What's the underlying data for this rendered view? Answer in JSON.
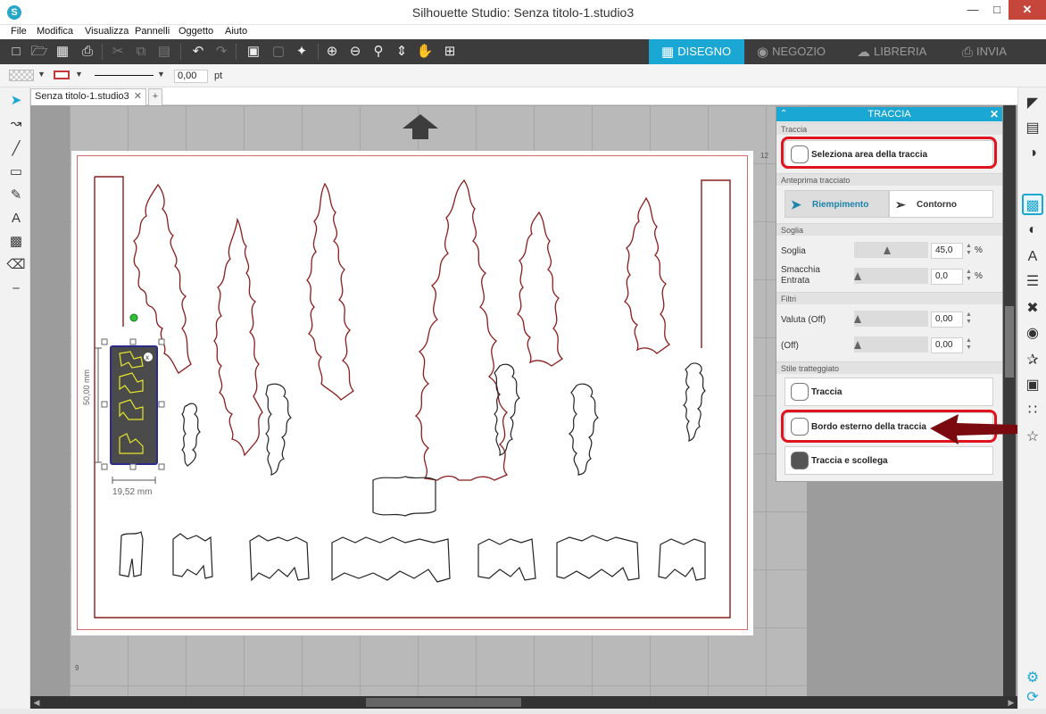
{
  "window": {
    "title": "Silhouette Studio: Senza titolo-1.studio3",
    "app_icon": "S"
  },
  "menu": [
    "File",
    "Modifica",
    "Visualizza",
    "Pannelli",
    "Oggetto",
    "Aiuto"
  ],
  "nav_tabs": [
    "DISEGNO",
    "NEGOZIO",
    "LIBRERIA",
    "INVIA"
  ],
  "options": {
    "line_width": "0,00",
    "line_unit": "pt",
    "line_color": "#c8373b"
  },
  "document_tab": "Senza titolo-1.studio3",
  "canvas": {
    "ruler_top_right": "12",
    "ruler_bottom_left": "9",
    "selection_height": "50,00 mm",
    "selection_width": "19,52 mm"
  },
  "panel": {
    "title": "TRACCIA",
    "section_traccia": "Traccia",
    "select_area_button": "Seleziona area della traccia",
    "section_preview": "Anteprima tracciato",
    "preview_fill": "Riempimento",
    "preview_outline": "Contorno",
    "section_threshold": "Soglia",
    "threshold_label": "Soglia",
    "threshold_value": "45,0",
    "threshold_unit": "%",
    "threshold_fraction": 0.45,
    "smudge_label": "Smacchia Entrata",
    "smudge_value": "0,0",
    "smudge_unit": "%",
    "smudge_fraction": 0.0,
    "section_filters": "Filtri",
    "filter_high_label": "Valuta (Off)",
    "filter_high_value": "0,00",
    "filter_low_label": "(Off)",
    "filter_low_value": "0,00",
    "section_style": "Stile tratteggiato",
    "style_trace": "Traccia",
    "style_outer_edge": "Bordo esterno della traccia",
    "style_trace_detach": "Traccia e scollega"
  },
  "colors": {
    "accent": "#1aa7d4",
    "highlight": "#e0141e",
    "callout_arrow": "#7a0a0f",
    "tree_stroke": "#8a1d1d"
  }
}
